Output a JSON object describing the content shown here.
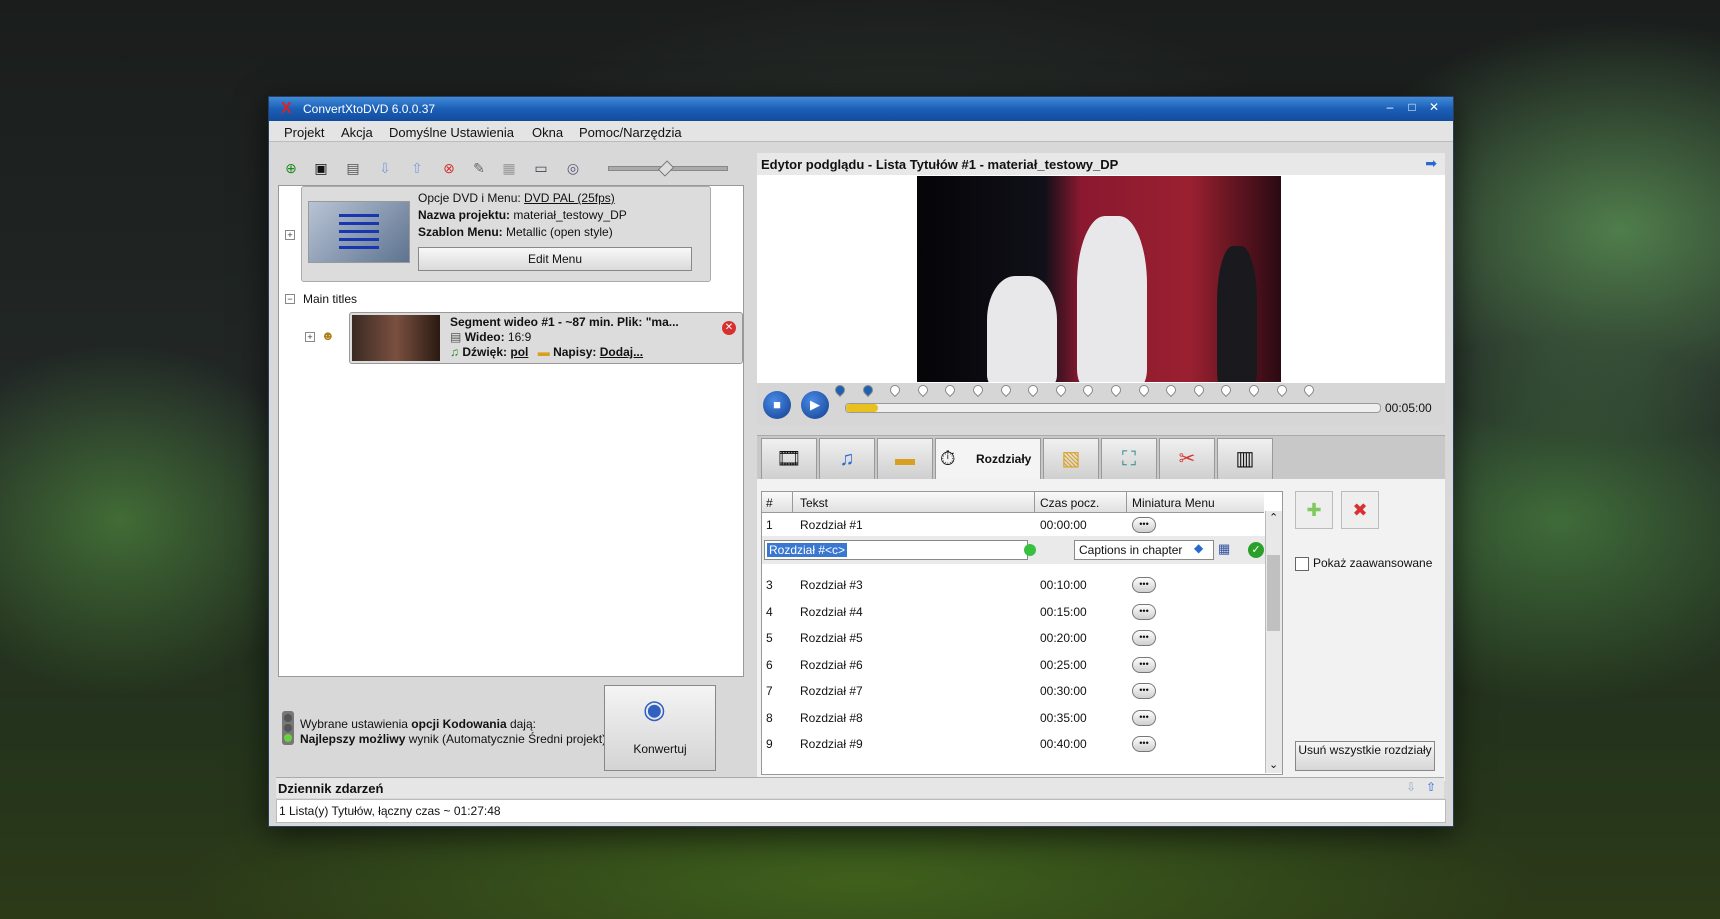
{
  "window": {
    "app_icon": "X",
    "title": "ConvertXtoDVD 6.0.0.37",
    "minimize": "–",
    "maximize": "□",
    "close": "✕"
  },
  "menu": [
    "Projekt",
    "Akcja",
    "Domyślne Ustawienia",
    "Okna",
    "Pomoc/Narzędzia"
  ],
  "toolbar": {
    "zoom_level": 0.45
  },
  "dvd": {
    "options_label": "Opcje DVD i Menu:",
    "options_value": "DVD PAL (25fps)",
    "project_label": "Nazwa projektu:",
    "project_value": "materiał_testowy_DP",
    "template_label": "Szablon Menu:",
    "template_value": "Metallic (open style)",
    "edit_menu": "Edit Menu"
  },
  "tree": {
    "main_titles": "Main titles",
    "expand_plus": "+",
    "collapse_minus": "−"
  },
  "segment": {
    "title": "Segment wideo #1 - ~87 min. Plik: \"ma...",
    "video_label": "Wideo:",
    "video_value": "16:9",
    "audio_label": "Dźwięk:",
    "audio_value": "pol",
    "subs_label": "Napisy:",
    "subs_value": "Dodaj..."
  },
  "encoding": {
    "line1_pre": "Wybrane ustawienia ",
    "line1_bold": "opcji Kodowania",
    "line1_post": " dają:",
    "line2_bold": "Najlepszy możliwy",
    "line2_post": " wynik (Automatycznie Średni projekt)"
  },
  "convert_button": "Konwertuj",
  "preview": {
    "title": "Edytor podglądu - Lista Tytułów #1 - materiał_testowy_DP",
    "time": "00:05:00",
    "progress": 0.06
  },
  "tabs": {
    "active_label": "Rozdziały"
  },
  "chapters": {
    "headers": [
      "#",
      "Tekst",
      "Czas pocz.",
      "Miniatura Menu"
    ],
    "rows": [
      {
        "n": "1",
        "text": "Rozdział #1",
        "time": "00:00:00"
      },
      {
        "n": "3",
        "text": "Rozdział #3",
        "time": "00:10:00"
      },
      {
        "n": "4",
        "text": "Rozdział #4",
        "time": "00:15:00"
      },
      {
        "n": "5",
        "text": "Rozdział #5",
        "time": "00:20:00"
      },
      {
        "n": "6",
        "text": "Rozdział #6",
        "time": "00:25:00"
      },
      {
        "n": "7",
        "text": "Rozdział #7",
        "time": "00:30:00"
      },
      {
        "n": "8",
        "text": "Rozdział #8",
        "time": "00:35:00"
      },
      {
        "n": "9",
        "text": "Rozdział #9",
        "time": "00:40:00"
      }
    ],
    "edit_value": "Rozdział #<c>",
    "combo_value": "Captions in chapter",
    "dots": "•••",
    "scroll_up": "⌃",
    "scroll_down": "⌄",
    "show_advanced": "Pokaż zaawansowane",
    "remove_all": "Usuń wszystkie rozdziały"
  },
  "log": {
    "title": "Dziennik zdarzeń",
    "line": "1 Lista(y) Tytułów, łączny czas ~ 01:27:48"
  },
  "colors": {
    "titlebar": "#1b5fb6",
    "selection": "#3a78d0",
    "stop_red": "#d83030",
    "ok_green": "#2aa02a"
  }
}
